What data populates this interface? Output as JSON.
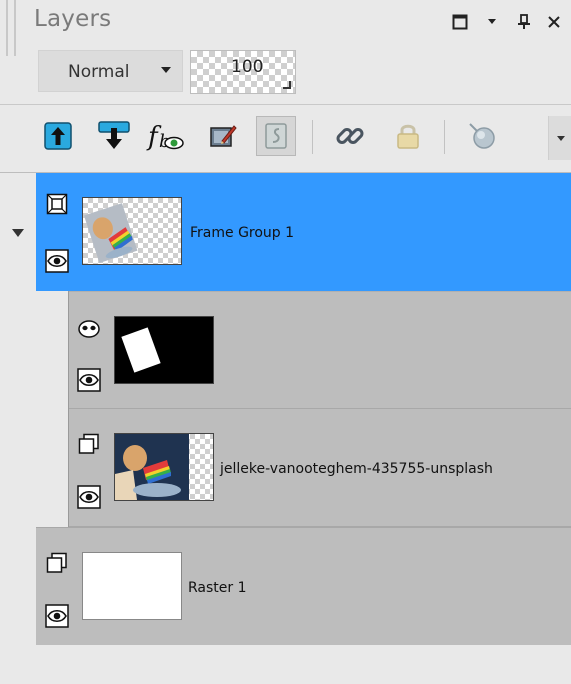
{
  "panel": {
    "title": "Layers",
    "window_buttons": [
      "maximize-icon",
      "dropdown-arrow-icon",
      "pin-icon",
      "close-icon"
    ]
  },
  "controls": {
    "blend_mode": "Normal",
    "opacity": "100"
  },
  "toolbar": {
    "buttons": [
      {
        "name": "move-layer-up-icon"
      },
      {
        "name": "move-layer-down-icon"
      },
      {
        "name": "layer-styles-icon"
      },
      {
        "name": "edit-selection-icon"
      },
      {
        "name": "lock-transparency-icon",
        "pressed": true
      },
      {
        "name": "link-layers-icon"
      },
      {
        "name": "lock-layer-icon"
      },
      {
        "name": "highlight-layer-icon"
      }
    ]
  },
  "layers": [
    {
      "name": "Frame Group 1",
      "type": "frame-group",
      "selected": true,
      "visible": true,
      "expanded": true
    },
    {
      "name": "",
      "type": "mask",
      "visible": true
    },
    {
      "name": "jelleke-vanooteghem-435755-unsplash",
      "type": "raster",
      "visible": true
    },
    {
      "name": "Raster 1",
      "type": "raster",
      "visible": true
    }
  ],
  "colors": {
    "selection": "#3399ff",
    "row_background": "#bdbdbd",
    "panel_background": "#e9e9e9"
  }
}
